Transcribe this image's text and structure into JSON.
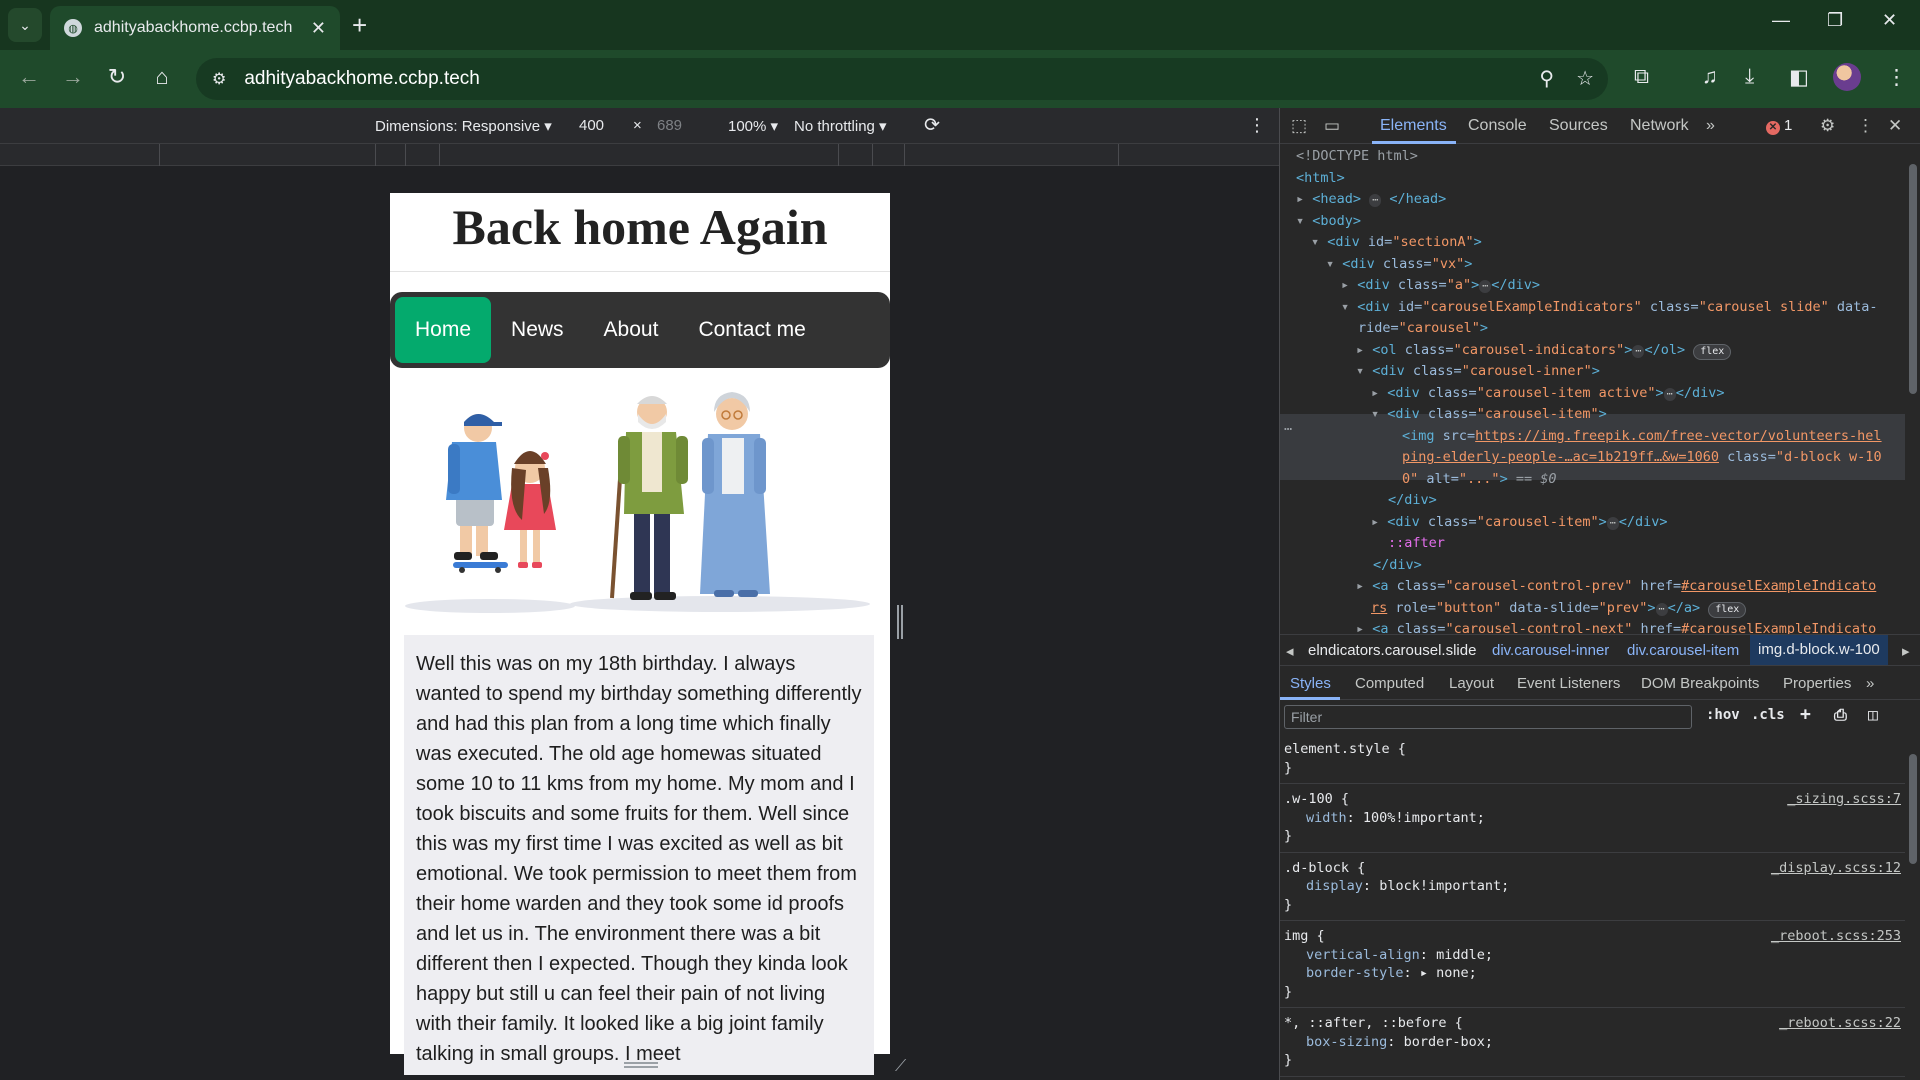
{
  "browser": {
    "tab_title": "adhityabackhome.ccbp.tech",
    "url": "adhityabackhome.ccbp.tech",
    "icons": {
      "tab_list": "chevron-down-icon",
      "new_tab": "plus-icon",
      "back": "back-arrow-icon",
      "forward": "forward-arrow-icon",
      "reload": "reload-icon",
      "home": "home-icon",
      "zoom": "zoom-icon",
      "bookmark": "star-icon"
    }
  },
  "device_toolbar": {
    "dimensions_label": "Dimensions: Responsive",
    "width": "400",
    "times": "×",
    "height": "689",
    "zoom": "100%",
    "throttling": "No throttling"
  },
  "page": {
    "heading": "Back home Again",
    "nav": [
      {
        "label": "Home",
        "active": true
      },
      {
        "label": "News",
        "active": false
      },
      {
        "label": "About",
        "active": false
      },
      {
        "label": "Contact me",
        "active": false
      }
    ],
    "story": "Well this was on my 18th birthday. I always wanted to spend my birthday something differently and had this plan from a long time which finally was executed. The old age homewas situated some 10 to 11 kms from my home. My mom and I took biscuits and some fruits for them. Well since this was my first time I was excited as well as bit emotional. We took permission to meet them from their home warden and they took some id proofs and let us in. The environment there was a bit different then I expected. Though they kinda look happy but still u can feel their pain of not living with their family. It looked like a big joint family talking in small groups. I meet"
  },
  "devtools": {
    "tabs": [
      "Elements",
      "Console",
      "Sources",
      "Network"
    ],
    "active_tab": "Elements",
    "more_tabs": "»",
    "error_count": "1",
    "dom": {
      "doctype": "<!DOCTYPE html>",
      "html": "<html>",
      "head_open": "<head>",
      "head_close": "</head>",
      "body": "<body>",
      "div_open": "<div",
      "div_close": "</div>",
      "id_attr": "id=",
      "class_attr": "class=",
      "sectionA": "\"sectionA\"",
      "vx": "\"vx\"",
      "a": "\"a\"",
      "carousel_id": "\"carouselExampleIndicators\"",
      "carousel_class": "\"carousel slide\"",
      "data_ride_1": "data-",
      "data_ride_2": "ride=",
      "carousel_val": "\"carousel\"",
      "ol_open": "<ol",
      "ol_close": "</ol>",
      "indicators": "\"carousel-indicators\"",
      "inner": "\"carousel-inner\"",
      "item_active": "\"carousel-item active\"",
      "item": "\"carousel-item\"",
      "img_open": "<img",
      "src_attr": "src=",
      "img_src_1": "https://img.freepik.com/free-vector/volunteers-hel",
      "img_src_2": "ping-elderly-people-…ac=1b219ff…&w=1060",
      "img_class_attr": "class=",
      "img_class_1": "\"d-block w-10",
      "img_class_2": "0\"",
      "alt_attr": "alt=",
      "alt_val": "\"...\"",
      "gt": ">",
      "eq": "== $0",
      "after": "::after",
      "a_open": "<a",
      "a_close": "</a>",
      "prev_class": "\"carousel-control-prev\"",
      "next_class": "\"carousel-control-next\"",
      "href_attr": "href=",
      "href_1": "#carouselExampleIndicato",
      "href_2": "rs",
      "role_attr": "role=",
      "role_val": "\"button\"",
      "slide_attr": "data-slide=",
      "slide_val": "\"prev\"",
      "flex": "flex",
      "ellipsis": "⋯",
      "row_dots": "…"
    },
    "breadcrumbs": [
      "elndicators.carousel.slide",
      "div.carousel-inner",
      "div.carousel-item",
      "img.d-block.w-100"
    ],
    "subtabs": [
      "Styles",
      "Computed",
      "Layout",
      "Event Listeners",
      "DOM Breakpoints",
      "Properties"
    ],
    "filter_placeholder": "Filter",
    "filter_buttons": [
      ":hov",
      ".cls"
    ],
    "rules": [
      {
        "selector": "element.style {",
        "source": "",
        "props": []
      },
      {
        "selector": ".w-100 {",
        "source": "_sizing.scss:7",
        "props": [
          {
            "name": "width",
            "value": "100%!important;"
          }
        ]
      },
      {
        "selector": ".d-block {",
        "source": "_display.scss:12",
        "props": [
          {
            "name": "display",
            "value": "block!important;"
          }
        ]
      },
      {
        "selector": "img {",
        "source": "_reboot.scss:253",
        "props": [
          {
            "name": "vertical-align",
            "value": "middle;"
          },
          {
            "name": "border-style",
            "value": "▸ none;"
          }
        ]
      },
      {
        "selector": "*, ::after, ::before {",
        "source": "_reboot.scss:22",
        "props": [
          {
            "name": "box-sizing",
            "value": "border-box;"
          }
        ]
      }
    ],
    "closing_brace": "}",
    "colon": ":"
  },
  "colors": {
    "nav_active": "#04aa6d",
    "nav_bg": "#333333",
    "browser_frame": "#1f4a2b"
  }
}
